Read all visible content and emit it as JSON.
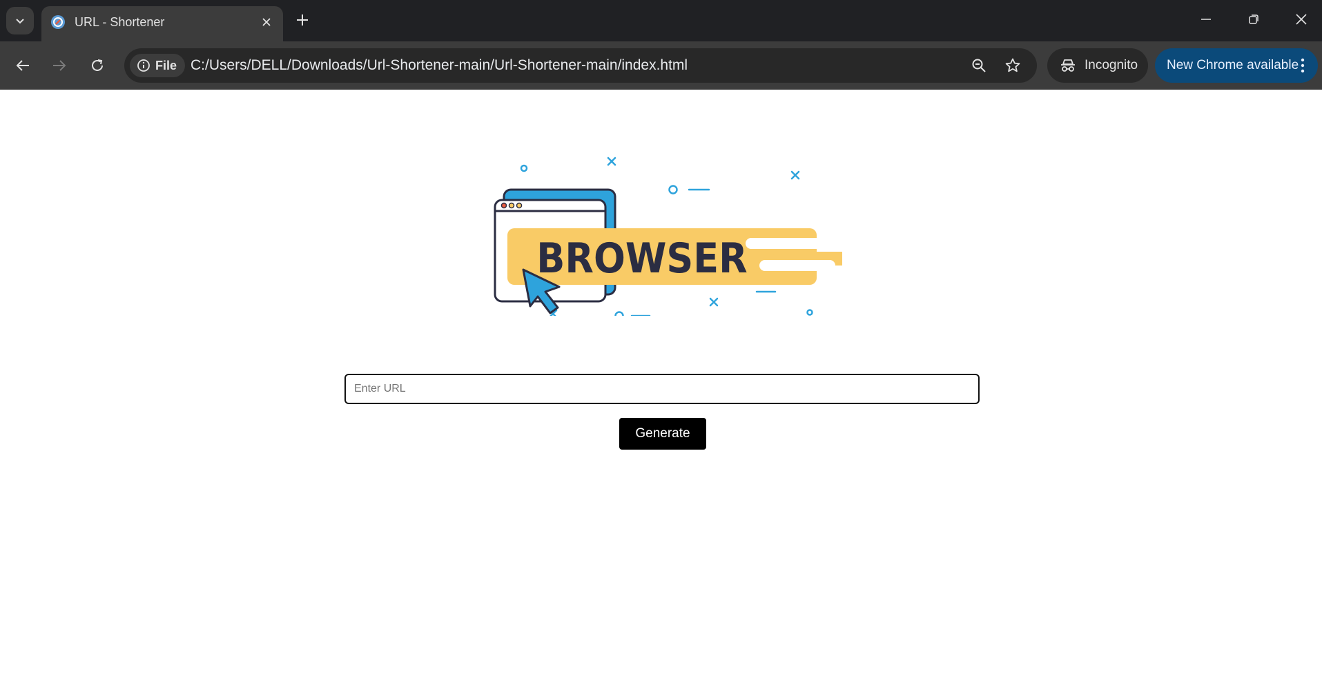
{
  "browser": {
    "tab": {
      "title": "URL - Shortener"
    },
    "omnibox": {
      "site_chip_label": "File",
      "url": "C:/Users/DELL/Downloads/Url-Shortener-main/Url-Shortener-main/index.html"
    },
    "profile_label": "Incognito",
    "update_label": "New Chrome available"
  },
  "page": {
    "hero": {
      "banner_text": "BROWSER"
    },
    "url_input": {
      "placeholder": "Enter URL",
      "value": ""
    },
    "generate_button_label": "Generate"
  },
  "colors": {
    "frame_dark": "#202124",
    "toolbar": "#3c3c3c",
    "update_chip": "#0b4a7a",
    "illustration_blue": "#2ea3dc",
    "illustration_yellow": "#f9cb66",
    "illustration_text": "#2b2d42",
    "button_bg": "#000000"
  },
  "icons": {
    "tab_search": "chevron-down-icon",
    "favicon": "link-shortener-favicon",
    "tab_close": "close-icon",
    "new_tab": "plus-icon",
    "minimize": "minimize-icon",
    "restore": "restore-icon",
    "close_window": "close-icon",
    "back": "arrow-left-icon",
    "forward": "arrow-right-icon",
    "reload": "reload-icon",
    "site_info": "info-icon",
    "zoom": "zoom-out-icon",
    "bookmark": "star-icon",
    "incognito": "incognito-icon",
    "menu": "kebab-icon"
  }
}
